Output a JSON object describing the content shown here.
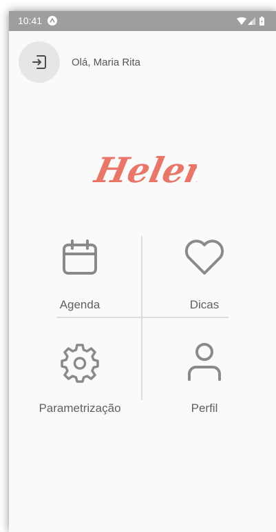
{
  "status_bar": {
    "time": "10:41",
    "background": "#9e9e9e"
  },
  "header": {
    "logout_icon": "logout-icon",
    "greeting": "Olá, Maria Rita"
  },
  "logo": {
    "text": "Helena",
    "color": "#e8776a"
  },
  "menu": {
    "items": [
      {
        "label": "Agenda",
        "icon": "calendar-icon"
      },
      {
        "label": "Dicas",
        "icon": "heart-icon"
      },
      {
        "label": "Parametrização",
        "icon": "gear-icon"
      },
      {
        "label": "Perfil",
        "icon": "user-icon"
      }
    ],
    "icon_color": "#8a8a8a"
  }
}
